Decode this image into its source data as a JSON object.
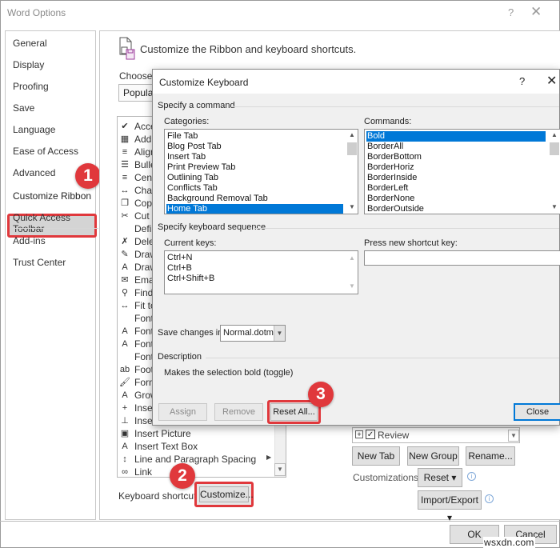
{
  "window": {
    "title": "Word Options",
    "help_label": "?",
    "close_label": "✕"
  },
  "sidebar": {
    "items": [
      {
        "label": "General"
      },
      {
        "label": "Display"
      },
      {
        "label": "Proofing"
      },
      {
        "label": "Save"
      },
      {
        "label": "Language"
      },
      {
        "label": "Ease of Access"
      },
      {
        "label": "Advanced"
      },
      {
        "label": "Customize Ribbon",
        "selected": true
      },
      {
        "label": "Quick Access Toolbar"
      },
      {
        "label": "Add-ins"
      },
      {
        "label": "Trust Center"
      }
    ]
  },
  "main": {
    "heading": "Customize the Ribbon and keyboard shortcuts.",
    "choose_label": "Choose c",
    "choose_value": "Popular",
    "commands": [
      {
        "icon": "accept-icon",
        "glyph": "✔",
        "label": "Accep"
      },
      {
        "icon": "table-icon",
        "glyph": "▦",
        "label": "Add T"
      },
      {
        "icon": "align-icon",
        "glyph": "≡",
        "label": "Align"
      },
      {
        "icon": "bullets-icon",
        "glyph": "☰",
        "label": "Bullet"
      },
      {
        "icon": "center-icon",
        "glyph": "≡",
        "label": "Cente"
      },
      {
        "icon": "change-icon",
        "glyph": "↔",
        "label": "Chan"
      },
      {
        "icon": "copy-icon",
        "glyph": "❐",
        "label": "Copy"
      },
      {
        "icon": "cut-icon",
        "glyph": "✂",
        "label": "Cut"
      },
      {
        "icon": "",
        "glyph": "",
        "label": "Defin"
      },
      {
        "icon": "delete-comment-icon",
        "glyph": "✗",
        "label": "Delet"
      },
      {
        "icon": "draw-icon",
        "glyph": "✎",
        "label": "Draw"
      },
      {
        "icon": "draw-textbox-icon",
        "glyph": "A",
        "label": "Draw"
      },
      {
        "icon": "email-icon",
        "glyph": "✉",
        "label": "Email"
      },
      {
        "icon": "find-icon",
        "glyph": "⚲",
        "label": "Find"
      },
      {
        "icon": "fit-icon",
        "glyph": "↔",
        "label": "Fit to"
      },
      {
        "icon": "",
        "glyph": "",
        "label": "Font"
      },
      {
        "icon": "font-color-icon",
        "glyph": "A",
        "label": "Font"
      },
      {
        "icon": "font-size-icon",
        "glyph": "A",
        "label": "Font"
      },
      {
        "icon": "",
        "glyph": "",
        "label": "Font"
      },
      {
        "icon": "footnote-icon",
        "glyph": "ab",
        "label": "Footn"
      },
      {
        "icon": "format-painter-icon",
        "glyph": "🖌",
        "label": "Form"
      },
      {
        "icon": "grow-font-icon",
        "glyph": "A",
        "label": "Grow"
      },
      {
        "icon": "insert-comment-icon",
        "glyph": "+",
        "label": "Insert"
      },
      {
        "icon": "insert-break-icon",
        "glyph": "⊥",
        "label": "Insert"
      },
      {
        "icon": "insert-picture-icon",
        "glyph": "▣",
        "label": "Insert Picture"
      },
      {
        "icon": "insert-textbox-icon",
        "glyph": "A",
        "label": "Insert Text Box"
      },
      {
        "icon": "line-spacing-icon",
        "glyph": "↕",
        "label": "Line and Paragraph Spacing"
      },
      {
        "icon": "link-icon",
        "glyph": "∞",
        "label": "Link"
      }
    ],
    "keyboard_shortcuts_label": "Keyboard shortcuts:",
    "customize_button": "Customize...",
    "review_item": "Review",
    "new_tab": "New Tab",
    "new_group": "New Group",
    "rename": "Rename...",
    "customizations_label": "Customizations:",
    "reset": "Reset ▾",
    "import_export": "Import/Export ▾",
    "ok": "OK",
    "cancel": "Cancel"
  },
  "dialog": {
    "title": "Customize Keyboard",
    "help_label": "?",
    "close_label": "✕",
    "specify_command": "Specify a command",
    "categories_label": "Categories:",
    "categories": [
      "File Tab",
      "Blog Post Tab",
      "Insert Tab",
      "Print Preview Tab",
      "Outlining Tab",
      "Conflicts Tab",
      "Background Removal Tab",
      "Home Tab"
    ],
    "selected_category": "Home Tab",
    "commands_label": "Commands:",
    "commands": [
      "Bold",
      "BorderAll",
      "BorderBottom",
      "BorderHoriz",
      "BorderInside",
      "BorderLeft",
      "BorderNone",
      "BorderOutside"
    ],
    "selected_command": "Bold",
    "specify_sequence": "Specify keyboard sequence",
    "current_keys_label": "Current keys:",
    "current_keys": [
      "Ctrl+N",
      "Ctrl+B",
      "Ctrl+Shift+B"
    ],
    "new_key_label": "Press new shortcut key:",
    "new_key_value": "",
    "save_changes_label": "Save changes in:",
    "save_changes_value": "Normal.dotm",
    "description_header": "Description",
    "description_text": "Makes the selection bold (toggle)",
    "assign": "Assign",
    "remove": "Remove",
    "reset_all": "Reset All...",
    "close": "Close"
  },
  "annotations": {
    "step1": "1",
    "step2": "2",
    "step3": "3",
    "color": "#e0383c"
  },
  "watermark": "wsxdn.com"
}
